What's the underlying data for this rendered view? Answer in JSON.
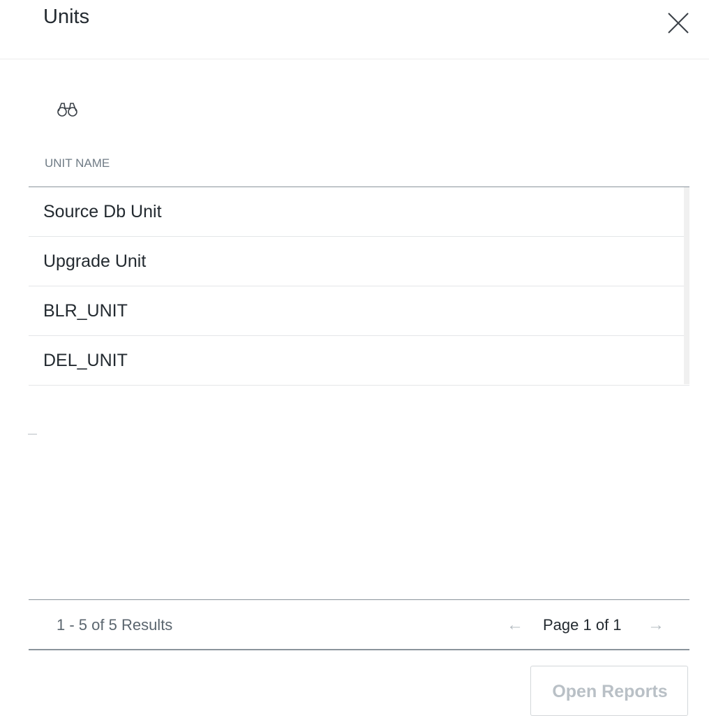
{
  "dialog": {
    "title": "Units",
    "close_icon": "close-icon"
  },
  "toolbar": {
    "search_icon": "binoculars-icon"
  },
  "table": {
    "columns": [
      "UNIT NAME"
    ],
    "rows": [
      {
        "unit_name": "Source Db Unit"
      },
      {
        "unit_name": "Upgrade Unit"
      },
      {
        "unit_name": "BLR_UNIT"
      },
      {
        "unit_name": "DEL_UNIT"
      }
    ]
  },
  "pagination": {
    "results_text": "1 - 5 of 5 Results",
    "page_text": "Page 1 of 1",
    "prev_icon": "arrow-left-icon",
    "next_icon": "arrow-right-icon"
  },
  "actions": {
    "open_reports_label": "Open Reports"
  },
  "colors": {
    "title_text": "#232a30",
    "muted_text": "#6f7b85",
    "divider": "#8a949c",
    "disabled_text": "#b9c0c6"
  }
}
